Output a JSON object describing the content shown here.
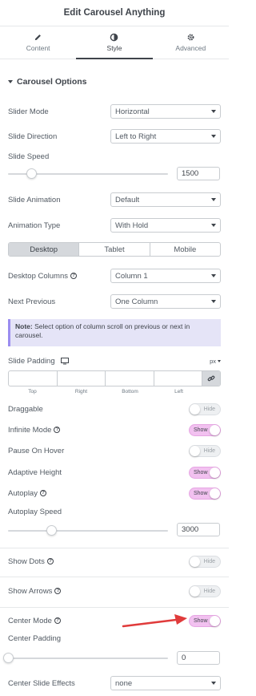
{
  "header": {
    "title": "Edit Carousel Anything"
  },
  "tabs": [
    {
      "label": "Content",
      "icon": "pencil-icon"
    },
    {
      "label": "Style",
      "icon": "half-circle-icon"
    },
    {
      "label": "Advanced",
      "icon": "gear-icon"
    }
  ],
  "section": {
    "title": "Carousel Options"
  },
  "fields": {
    "slider_mode": {
      "label": "Slider Mode",
      "value": "Horizontal"
    },
    "slide_direction": {
      "label": "Slide Direction",
      "value": "Left to Right"
    },
    "slide_speed": {
      "label": "Slide Speed",
      "value": "1500",
      "level": 0.15
    },
    "slide_animation": {
      "label": "Slide Animation",
      "value": "Default"
    },
    "animation_type": {
      "label": "Animation Type",
      "value": "With Hold"
    },
    "device_tabs": [
      "Desktop",
      "Tablet",
      "Mobile"
    ],
    "desktop_columns": {
      "label": "Desktop Columns",
      "value": "Column 1"
    },
    "next_previous": {
      "label": "Next Previous",
      "value": "One Column"
    },
    "note": {
      "prefix": "Note:",
      "text": " Select option of column scroll on previous or next in carousel."
    },
    "slide_padding": {
      "label": "Slide Padding",
      "unit": "px",
      "sides": [
        "Top",
        "Right",
        "Bottom",
        "Left"
      ]
    },
    "draggable": {
      "label": "Draggable",
      "state": "Hide"
    },
    "infinite_mode": {
      "label": "Infinite Mode",
      "state": "Show"
    },
    "pause_on_hover": {
      "label": "Pause On Hover",
      "state": "Hide"
    },
    "adaptive_height": {
      "label": "Adaptive Height",
      "state": "Show"
    },
    "autoplay": {
      "label": "Autoplay",
      "state": "Show"
    },
    "autoplay_speed": {
      "label": "Autoplay Speed",
      "value": "3000",
      "level": 0.3
    },
    "show_dots": {
      "label": "Show Dots",
      "state": "Hide"
    },
    "show_arrows": {
      "label": "Show Arrows",
      "state": "Hide"
    },
    "center_mode": {
      "label": "Center Mode",
      "state": "Show"
    },
    "center_padding": {
      "label": "Center Padding",
      "value": "0",
      "level": 0
    },
    "center_slide_effects": {
      "label": "Center Slide Effects",
      "value": "none"
    }
  },
  "colors": {
    "annotation_arrow": "#e03b3b",
    "toggle_on": "#f2c1f0",
    "note_bg": "#e5e4f7"
  }
}
